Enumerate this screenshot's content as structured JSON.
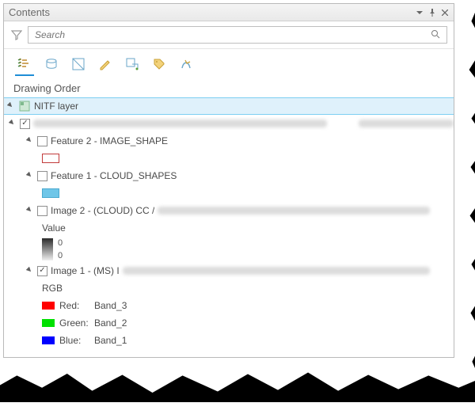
{
  "title": "Contents",
  "search": {
    "placeholder": "Search"
  },
  "section": "Drawing Order",
  "tree": {
    "nitf": "NITF layer",
    "feature2": "Feature 2 - IMAGE_SHAPE",
    "feature1": "Feature 1 - CLOUD_SHAPES",
    "image2_prefix": "Image 2 - (CLOUD) CC /",
    "value_label": "Value",
    "value_top": "0",
    "value_bottom": "0",
    "image1_prefix": "Image 1 - (MS) I",
    "rgb_label": "RGB",
    "bands": {
      "red": {
        "label": "Red:",
        "value": "Band_3"
      },
      "green": {
        "label": "Green:",
        "value": "Band_2"
      },
      "blue": {
        "label": "Blue:",
        "value": "Band_1"
      }
    }
  }
}
